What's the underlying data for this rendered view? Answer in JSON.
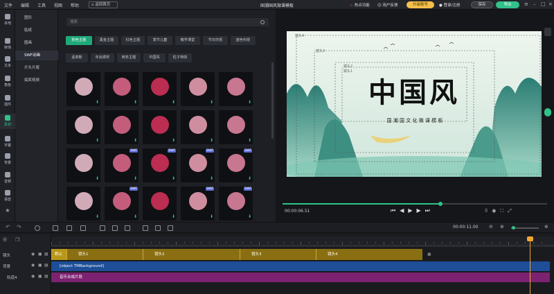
{
  "menu": [
    "文件",
    "编辑",
    "工具",
    "视图",
    "帮助"
  ],
  "back_button": "返回首页",
  "doc_title": "国潮国风微课模板",
  "hot_features": "热点功能",
  "feedback": "用户反馈",
  "upgrade_button": "升级账号",
  "login": "登录/注册",
  "save_button": "保存",
  "export_button": "导出",
  "rail": [
    {
      "label": "本地",
      "icon": "folder-icon"
    },
    {
      "label": "转场",
      "icon": "transition-icon"
    },
    {
      "label": "文本",
      "icon": "text-icon"
    },
    {
      "label": "角色",
      "icon": "character-icon"
    },
    {
      "label": "插件",
      "icon": "plugin-icon"
    },
    {
      "label": "素材",
      "icon": "material-icon"
    },
    {
      "label": "字幕",
      "icon": "subtitle-icon"
    },
    {
      "label": "背景",
      "icon": "background-icon"
    },
    {
      "label": "音频",
      "icon": "audio-icon"
    },
    {
      "label": "语音",
      "icon": "voice-icon"
    }
  ],
  "categories": [
    "图形",
    "贴纸",
    "圆画",
    "SWF动画",
    "片头片尾",
    "搞笑视频"
  ],
  "search_placeholder": "搜索",
  "tags_row1": [
    "粉色主题",
    "黑金主题",
    "红色主题",
    "季节儿童",
    "教学课堂",
    "节日庆祝",
    "蓝色科技"
  ],
  "tags_row2": [
    "孟菲斯",
    "年会颁奖",
    "商务主题",
    "中国风",
    "粒子特效"
  ],
  "thumbnails": [
    {
      "name": "umbrella-white",
      "tag": ""
    },
    {
      "name": "plum-branch",
      "tag": ""
    },
    {
      "name": "pink-flower-burst",
      "tag": ""
    },
    {
      "name": "hanging-charm",
      "tag": ""
    },
    {
      "name": "umbrella-pink",
      "tag": ""
    },
    {
      "name": "peony-flowers",
      "tag": ""
    },
    {
      "name": "wind-chime",
      "tag": ""
    },
    {
      "name": "wind-chime-2",
      "tag": ""
    },
    {
      "name": "plum-sprig",
      "tag": ""
    },
    {
      "name": "plum-sprig-2",
      "tag": ""
    },
    {
      "name": "bird-branch",
      "tag": ""
    },
    {
      "name": "magpie-branch",
      "tag": "SWF"
    },
    {
      "name": "fan-flower",
      "tag": "SWF"
    },
    {
      "name": "pink-tree",
      "tag": "SWF"
    },
    {
      "name": "falling-blossoms",
      "tag": "SWF"
    },
    {
      "name": "blossom-branch",
      "tag": ""
    },
    {
      "name": "plum-cluster",
      "tag": "SWF"
    },
    {
      "name": "pink-balloons",
      "tag": ""
    },
    {
      "name": "girl-dancing",
      "tag": "SWF"
    },
    {
      "name": "hot-air-balloon",
      "tag": "SWF"
    }
  ],
  "preview": {
    "title_main": "中国风",
    "subtitle": "国 潮 国 文 化 微 课 模 板",
    "frame_labels": [
      "镜头4",
      "镜头3",
      "镜头2",
      "镜头1"
    ],
    "time_current": "00:00:06.51"
  },
  "timeline": {
    "duration": "00:00:11.00",
    "tracks": [
      "镜头",
      "背景",
      "轨道4"
    ],
    "shots": [
      "镜头1",
      "镜头2",
      "镜头3",
      "镜头4"
    ],
    "first_shot_label": "默认",
    "bg_clip": "[object TMBackground]",
    "music_clip": "音乐合成片段"
  },
  "colors": {
    "accent": "#2fc28a",
    "upgrade": "#f5c04a",
    "shot_clip": "#8a6f12",
    "bg_clip": "#1d4e97",
    "music_clip": "#7c2270",
    "playhead": "#f2a533"
  }
}
